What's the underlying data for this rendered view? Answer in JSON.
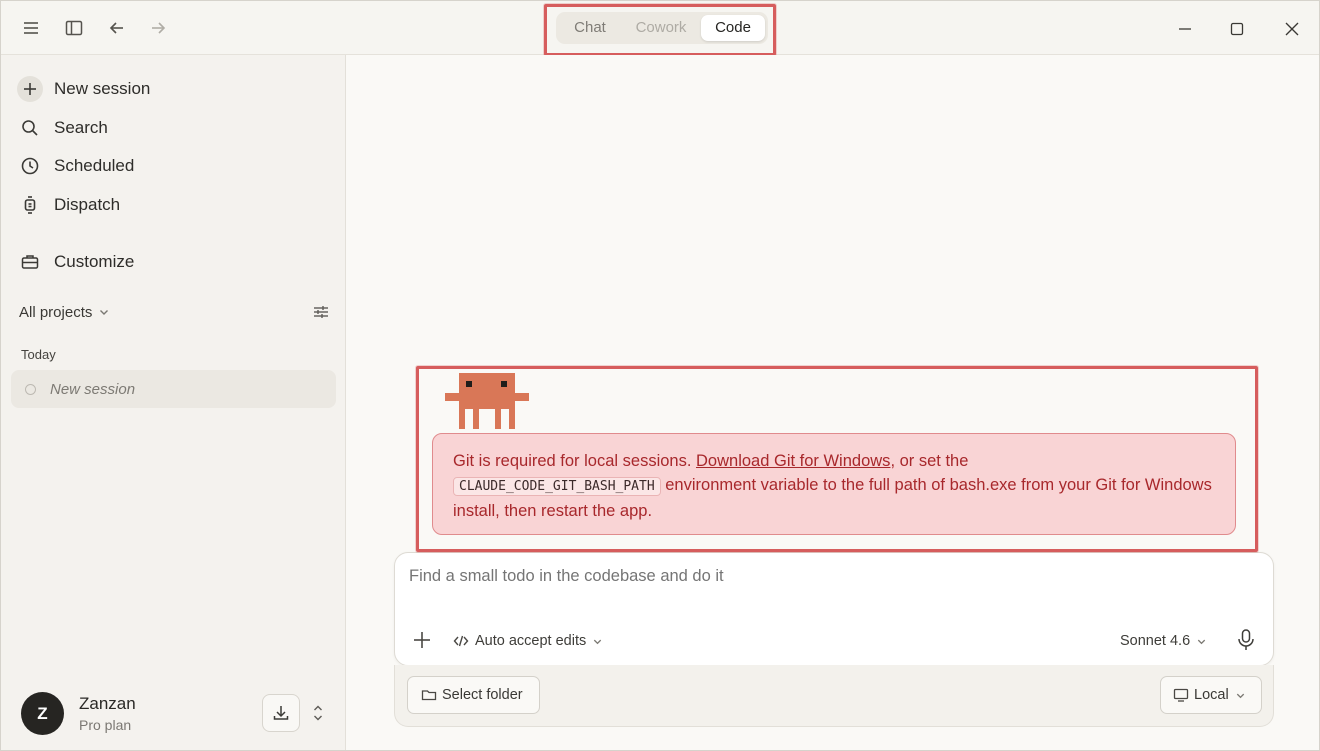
{
  "titlebar": {
    "modes": [
      {
        "label": "Chat"
      },
      {
        "label": "Cowork"
      },
      {
        "label": "Code"
      }
    ],
    "icons": [
      "menu-icon",
      "sidebar-toggle-icon",
      "back-arrow-icon",
      "forward-arrow-icon",
      "minimize-icon",
      "maximize-icon",
      "close-icon"
    ]
  },
  "sidebar": {
    "items": [
      {
        "label": "New session",
        "icon": "plus-icon"
      },
      {
        "label": "Search",
        "icon": "search-icon"
      },
      {
        "label": "Scheduled",
        "icon": "clock-icon"
      },
      {
        "label": "Dispatch",
        "icon": "watch-icon"
      },
      {
        "label": "Customize",
        "icon": "toolbox-icon"
      }
    ],
    "projects_filter": "All projects",
    "section_today": "Today",
    "sessions": [
      {
        "label": "New session"
      }
    ],
    "user": {
      "initial": "Z",
      "name": "Zanzan",
      "plan": "Pro plan"
    }
  },
  "main": {
    "error": {
      "text_1": "Git is required for local sessions. ",
      "link": "Download Git for Windows",
      "text_2": ", or set the",
      "code": "CLAUDE_CODE_GIT_BASH_PATH",
      "text_3": " environment variable to the full path of bash.exe from your Git for Windows install, then restart the app."
    },
    "composer": {
      "placeholder": "Find a small todo in the codebase and do it",
      "mode_label": "Auto accept edits",
      "model_label": "Sonnet 4.6"
    },
    "bottom": {
      "folder_label": "Select folder",
      "env_label": "Local"
    }
  },
  "colors": {
    "error_bg": "#f9d4d5",
    "error_text": "#a8282c",
    "highlight": "#d65d5d",
    "mascot": "#d97757"
  }
}
